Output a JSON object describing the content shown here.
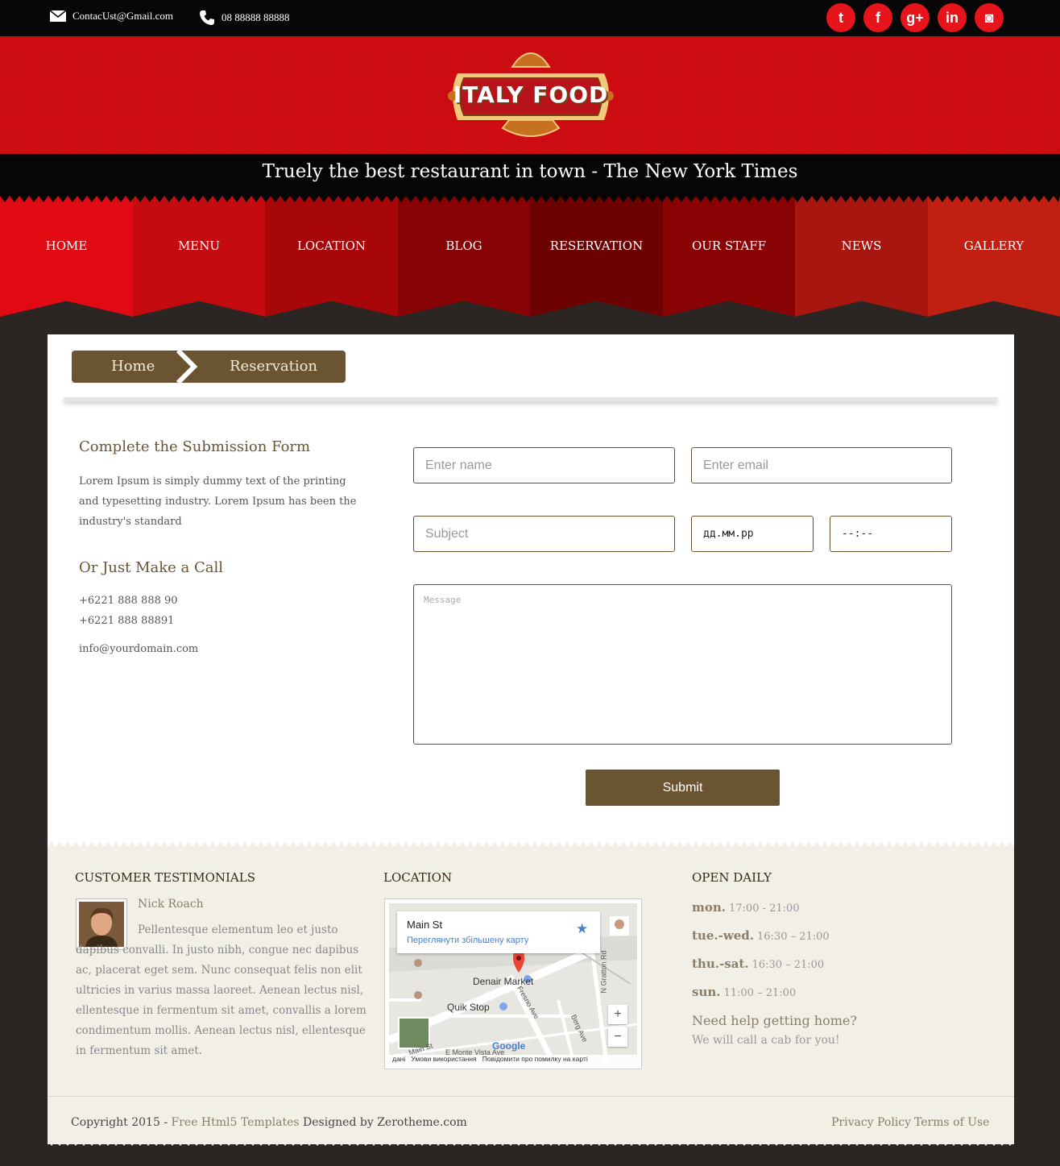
{
  "topbar": {
    "email": "ContacUst@Gmail.com",
    "phone": "08 88888 88888",
    "social": [
      {
        "name": "twitter-icon",
        "glyph": "t"
      },
      {
        "name": "facebook-icon",
        "glyph": "f"
      },
      {
        "name": "google-plus-icon",
        "glyph": "g+"
      },
      {
        "name": "linkedin-icon",
        "glyph": "in"
      },
      {
        "name": "instagram-icon",
        "glyph": "◙"
      }
    ]
  },
  "brand": {
    "logo_text": "ITALY FOOD"
  },
  "tagline": "Truely the best restaurant in town - The New York Times",
  "nav": {
    "items": [
      {
        "label": "HOME",
        "color": "#e20a12"
      },
      {
        "label": "MENU",
        "color": "#c40c10"
      },
      {
        "label": "LOCATION",
        "color": "#a8070a"
      },
      {
        "label": "BLOG",
        "color": "#870306"
      },
      {
        "label": "RESERVATION",
        "color": "#6d0203"
      },
      {
        "label": "OUR STAFF",
        "color": "#8a0304"
      },
      {
        "label": "NEWS",
        "color": "#a81610"
      },
      {
        "label": "GALLERY",
        "color": "#c11f12"
      }
    ]
  },
  "breadcrumb": {
    "home": "Home",
    "current": "Reservation"
  },
  "form_info": {
    "heading": "Complete the Submission Form",
    "paragraph": "Lorem Ipsum is simply dummy text of the printing and typesetting industry. Lorem Ipsum has been the industry's standard",
    "call_heading": "Or Just Make a Call",
    "phone1": "+6221 888 888 90",
    "phone2": "+6221 888 88891",
    "email": "info@yourdomain.com"
  },
  "form": {
    "name_placeholder": "Enter name",
    "email_placeholder": "Enter email",
    "subject_placeholder": "Subject",
    "date_placeholder": "дд.мм.рр",
    "time_placeholder": "--:--",
    "message_placeholder": "Message",
    "submit_label": "Submit"
  },
  "footer": {
    "testimonials_heading": "CUSTOMER TESTIMONIALS",
    "testimonial_name": "Nick Roach",
    "testimonial_text": "Pellentesque elementum leo et justo dapibus convalli. In justo nibh, congue nec dapibus ac, placerat eget sem. Nunc consequat felis non elit ultricies in varius massa laoreet. Aenean lectus nisl, ellentesque in fermentum sit amet, convallis a lorem condimentum mollis. Aenean lectus nisl, ellentesque in fermentum sit amet.",
    "location_heading": "LOCATION",
    "map": {
      "title": "Main St",
      "link": "Переглянути збільшену карту",
      "labels": [
        "Denair Market",
        "Quik Stop",
        "Fresno Ave",
        "Berg Ave",
        "N Gratton Rd",
        "Main St",
        "E Monte Vista Ave"
      ],
      "google": "Google",
      "footer_items": [
        "дані",
        "Умови використання",
        "Повідомити про помилку на карті"
      ],
      "zoom_in": "+",
      "zoom_out": "−"
    },
    "open_heading": "OPEN DAILY",
    "hours": [
      {
        "day": "mon.",
        "time": "17:00 - 21:00"
      },
      {
        "day": "tue.-wed.",
        "time": "16:30 – 21:00"
      },
      {
        "day": "thu.-sat.",
        "time": "16:30 – 21:00"
      },
      {
        "day": "sun.",
        "time": "11:00 – 21:00"
      }
    ],
    "help_heading": "Need help getting home?",
    "help_text": "We will call a cab for you!",
    "copyright_prefix": "Copyright 2015 -",
    "copyright_link": "Free Html5 Templates",
    "copyright_suffix": "Designed by Zerotheme.com",
    "privacy": "Privacy Policy",
    "terms": "Terms of Use"
  }
}
